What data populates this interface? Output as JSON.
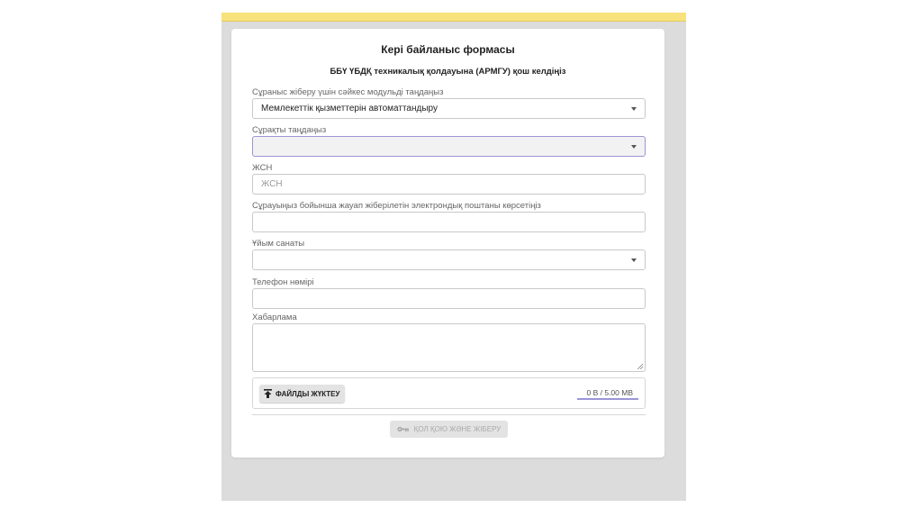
{
  "form": {
    "title": "Кері байланыс формасы",
    "subtitle": "ББҮ ҮБДҚ техникалық қолдауына (АРМГУ) қош келдіңіз",
    "module_label": "Сұраныс жіберу үшін сәйкес модульді таңдаңыз",
    "module_value": "Мемлекеттік қызметтерін автоматтандыру",
    "question_label": "Сұрақты таңдаңыз",
    "question_value": "",
    "iin_label": "ЖСН",
    "iin_placeholder": "ЖСН",
    "email_label": "Сұрауыңыз бойынша жауап жіберілетін электрондық поштаны көрсетіңіз",
    "email_value": "",
    "org_label": "Ұйым санаты",
    "org_value": "",
    "phone_label": "Телефон нөмірі",
    "phone_value": "",
    "message_label": "Хабарлама",
    "message_value": "",
    "upload_label": "ФАЙЛДЫ ЖҮКТЕУ",
    "upload_size": "0 B / 5.00 MB",
    "submit_label": "ҚОЛ ҚОЮ ЖӘНЕ ЖІБЕРУ"
  },
  "icons": {
    "upload": "upload-icon",
    "key": "key-icon",
    "dropdown": "chevron-down-icon"
  },
  "colors": {
    "page_bg": "#ffffff",
    "viewport_bg": "#dcdcdc",
    "topbar": "#f7e27b",
    "card_bg": "#ffffff",
    "active_border": "#9b95d6"
  }
}
